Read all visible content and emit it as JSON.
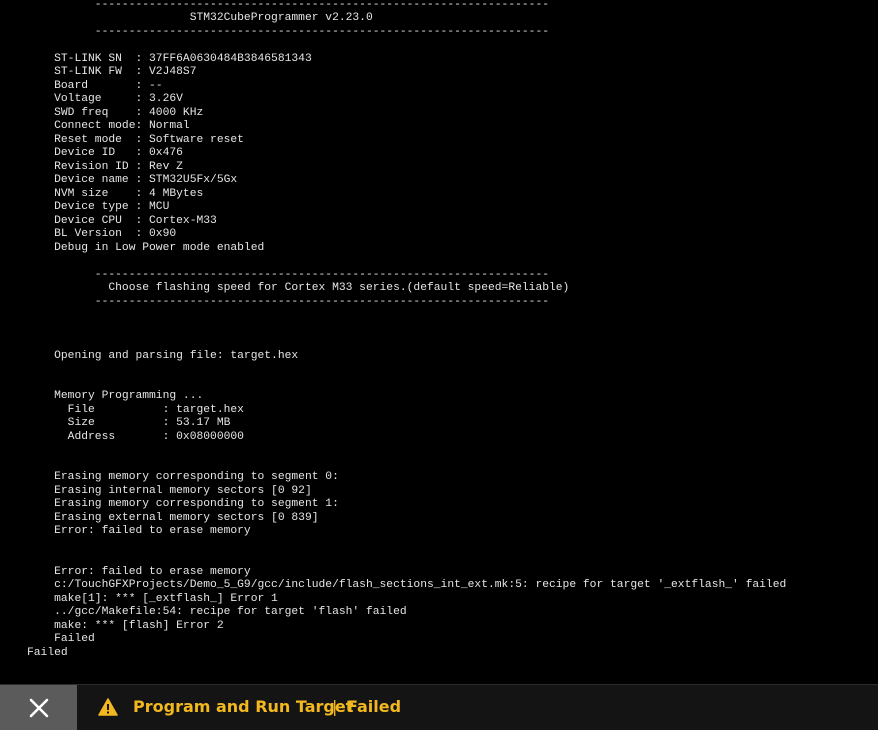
{
  "console": {
    "lines": [
      "          -------------------------------------------------------------------",
      "                        STM32CubeProgrammer v2.23.0",
      "          -------------------------------------------------------------------",
      "",
      "    ST-LINK SN  : 37FF6A0630484B3846581343",
      "    ST-LINK FW  : V2J48S7",
      "    Board       : --",
      "    Voltage     : 3.26V",
      "    SWD freq    : 4000 KHz",
      "    Connect mode: Normal",
      "    Reset mode  : Software reset",
      "    Device ID   : 0x476",
      "    Revision ID : Rev Z",
      "    Device name : STM32U5Fx/5Gx",
      "    NVM size    : 4 MBytes",
      "    Device type : MCU",
      "    Device CPU  : Cortex-M33",
      "    BL Version  : 0x90",
      "    Debug in Low Power mode enabled",
      "",
      "          -------------------------------------------------------------------",
      "            Choose flashing speed for Cortex M33 series.(default speed=Reliable)",
      "          -------------------------------------------------------------------",
      "",
      "",
      "",
      "    Opening and parsing file: target.hex",
      "",
      "",
      "    Memory Programming ...",
      "      File          : target.hex",
      "      Size          : 53.17 MB",
      "      Address       : 0x08000000",
      "",
      "",
      "    Erasing memory corresponding to segment 0:",
      "    Erasing internal memory sectors [0 92]",
      "    Erasing memory corresponding to segment 1:",
      "    Erasing external memory sectors [0 839]",
      "    Error: failed to erase memory",
      "",
      "",
      "    Error: failed to erase memory",
      "    c:/TouchGFXProjects/Demo_5_G9/gcc/include/flash_sections_int_ext.mk:5: recipe for target '_extflash_' failed",
      "    make[1]: *** [_extflash_] Error 1",
      "    ../gcc/Makefile:54: recipe for target 'flash' failed",
      "    make: *** [flash] Error 2",
      "    Failed",
      "Failed"
    ]
  },
  "status_bar": {
    "close_icon": "close-icon",
    "warning_icon": "warning-icon",
    "title": "Program and Run Target",
    "separator": "|",
    "result": "Failed",
    "accent_color": "#f2b81e"
  }
}
